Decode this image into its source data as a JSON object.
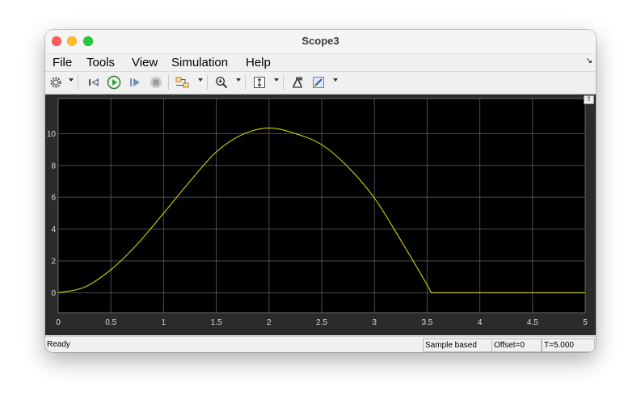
{
  "window": {
    "title": "Scope3"
  },
  "menu": {
    "items": [
      "File",
      "Tools",
      "View",
      "Simulation",
      "Help"
    ]
  },
  "toolbar": {
    "icons": [
      "settings-gear-icon",
      "step-back-icon",
      "run-icon",
      "step-forward-icon",
      "stop-icon",
      "signal-routing-icon",
      "zoom-in-icon",
      "autoscale-icon",
      "highlight-block-icon",
      "style-icon"
    ]
  },
  "status": {
    "ready": "Ready",
    "sample_mode": "Sample based",
    "offset": "Offset=0",
    "time": "T=5.000"
  },
  "colors": {
    "plot_background": "#000000",
    "signal": "#e6e600",
    "grid": "#4d4d4d",
    "tick_label": "#d9d9d9"
  },
  "chart_data": {
    "type": "line",
    "title": "",
    "xlabel": "",
    "ylabel": "",
    "xlim": [
      0,
      5
    ],
    "ylim": [
      -1.25,
      12.2
    ],
    "xticks": [
      0,
      0.5,
      1,
      1.5,
      2,
      2.5,
      3,
      3.5,
      4,
      4.5,
      5
    ],
    "yticks": [
      0,
      2,
      4,
      6,
      8,
      10
    ],
    "grid": true,
    "series": [
      {
        "x": [
          0,
          0.25,
          0.5,
          0.75,
          1.0,
          1.25,
          1.5,
          1.75,
          2.0,
          2.25,
          2.5,
          2.75,
          3.0,
          3.25,
          3.5,
          3.54,
          4.0,
          4.5,
          5.0
        ],
        "y": [
          0,
          0.35,
          1.45,
          3.05,
          5.0,
          7.0,
          8.85,
          9.95,
          10.35,
          10.0,
          9.3,
          7.9,
          5.95,
          3.3,
          0.5,
          0,
          0,
          0,
          0
        ]
      }
    ]
  }
}
